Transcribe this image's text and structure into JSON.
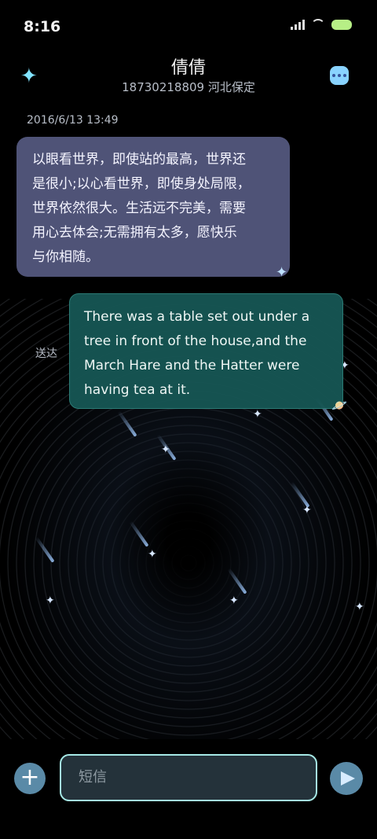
{
  "status_bar": {
    "time": "8:16"
  },
  "header": {
    "contact_name": "倩倩",
    "contact_sub": "18730218809 河北保定"
  },
  "conversation": {
    "date": "2016/6/13 13:49",
    "incoming": {
      "lines": [
        "以眼看世界，即使站的最高，世界还",
        "是很小;以心看世界，即使身处局限，",
        "世界依然很大。生活远不完美，需要",
        "用心去体会;无需拥有太多，愿快乐",
        "与你相随。"
      ]
    },
    "outgoing": {
      "lines": [
        "There was a table set out under a",
        "tree in front of the house,and the",
        "March Hare and the Hatter were",
        "having tea at it."
      ],
      "status": "送达"
    }
  },
  "composer": {
    "placeholder": "短信"
  },
  "icons": {
    "star": "star-icon",
    "more": "more-icon",
    "add": "plus-icon",
    "send": "send-icon"
  },
  "colors": {
    "incoming_bubble": "#4f5377",
    "outgoing_bubble": "#165654",
    "accent": "#a6e9e6"
  }
}
